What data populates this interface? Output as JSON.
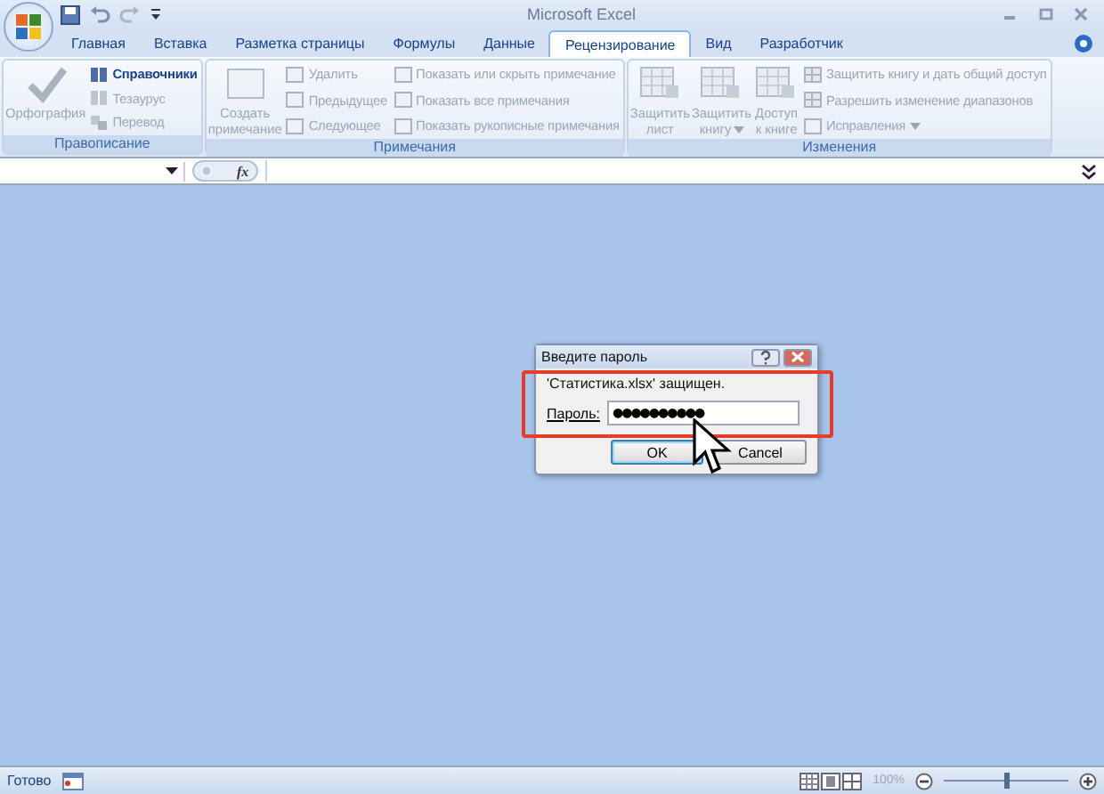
{
  "window": {
    "title": "Microsoft Excel"
  },
  "tabs": [
    {
      "label": "Главная",
      "selected": false
    },
    {
      "label": "Вставка",
      "selected": false
    },
    {
      "label": "Разметка страницы",
      "selected": false
    },
    {
      "label": "Формулы",
      "selected": false
    },
    {
      "label": "Данные",
      "selected": false
    },
    {
      "label": "Рецензирование",
      "selected": true
    },
    {
      "label": "Вид",
      "selected": false
    },
    {
      "label": "Разработчик",
      "selected": false
    }
  ],
  "ribbon_groups": [
    {
      "title": "Правописание",
      "large": [
        {
          "label": "Орфография",
          "disabled": true,
          "menu": false
        }
      ],
      "columns": [
        [
          {
            "label": "Справочники",
            "disabled": false,
            "menu": false
          },
          {
            "label": "Тезаурус",
            "disabled": true,
            "menu": false
          },
          {
            "label": "Перевод",
            "disabled": true,
            "menu": false
          }
        ]
      ]
    },
    {
      "title": "Примечания",
      "large": [
        {
          "label": "Создать\nпримечание",
          "disabled": true,
          "menu": false
        }
      ],
      "columns": [
        [
          {
            "label": "Удалить",
            "disabled": true,
            "menu": false
          },
          {
            "label": "Предыдущее",
            "disabled": true,
            "menu": false
          },
          {
            "label": "Следующее",
            "disabled": true,
            "menu": false
          }
        ],
        [
          {
            "label": "Показать или скрыть примечание",
            "disabled": true,
            "menu": false
          },
          {
            "label": "Показать все примечания",
            "disabled": true,
            "menu": false
          },
          {
            "label": "Показать рукописные примечания",
            "disabled": true,
            "menu": false
          }
        ]
      ]
    },
    {
      "title": "Изменения",
      "large": [
        {
          "label": "Защитить\nлист",
          "disabled": true,
          "menu": false
        },
        {
          "label": "Защитить\nкнигу",
          "disabled": true,
          "menu": true
        },
        {
          "label": "Доступ\nк книге",
          "disabled": true,
          "menu": false
        }
      ],
      "columns": [
        [
          {
            "label": "Защитить книгу и дать общий доступ",
            "disabled": true,
            "menu": false
          },
          {
            "label": "Разрешить изменение диапазонов",
            "disabled": true,
            "menu": false
          },
          {
            "label": "Исправления",
            "disabled": true,
            "menu": true
          }
        ]
      ]
    }
  ],
  "formula_bar": {
    "fx_label": "fx"
  },
  "dialog": {
    "title": "Введите пароль",
    "message": "'Статистика.xlsx' защищен.",
    "password_label": "Пароль:",
    "password_value": "●●●●●●●●●●",
    "buttons": [
      {
        "label": "OK",
        "selected": true
      },
      {
        "label": "Cancel",
        "selected": false
      }
    ]
  },
  "status_bar": {
    "status": "Готово",
    "zoom": "100%",
    "zoom_slider": {
      "level": 0.5
    }
  }
}
